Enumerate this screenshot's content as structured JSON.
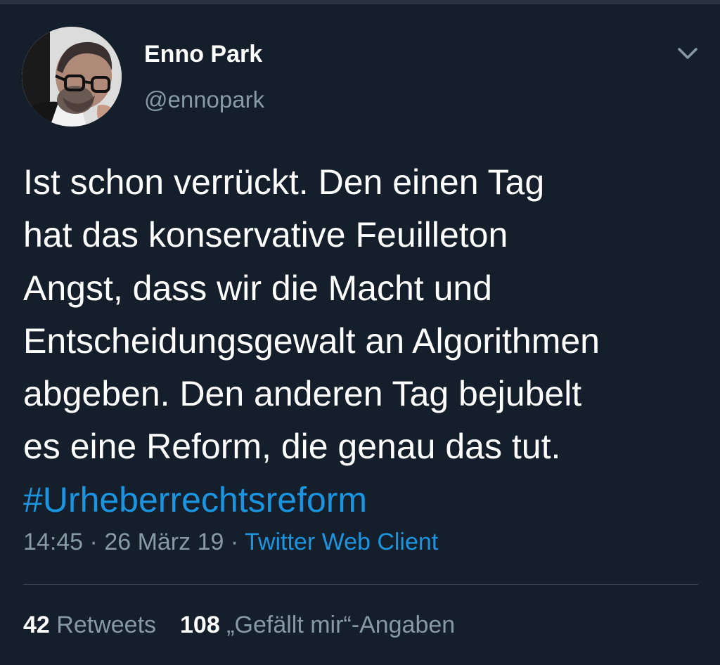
{
  "author": {
    "display_name": "Enno Park",
    "handle": "@ennopark"
  },
  "icons": {
    "menu": "chevron-down-icon",
    "avatar": "profile-photo"
  },
  "tweet": {
    "lines": [
      "Ist schon verrückt. Den einen Tag",
      "hat das konservative Feuilleton",
      "Angst, dass wir die Macht und",
      "Entscheidungsgewalt an Algorithmen",
      "abgeben. Den anderen Tag bejubelt",
      "es eine Reform, die genau das tut."
    ],
    "hashtag": "#Urheberrechtsreform"
  },
  "meta": {
    "time": "14:45",
    "separator": " · ",
    "date": "26 März 19",
    "client": "Twitter Web Client"
  },
  "stats": {
    "retweets_count": "42",
    "retweets_label": "Retweets",
    "likes_count": "108",
    "likes_label": "„Gefällt mir“-Angaben"
  },
  "colors": {
    "background": "#151f2b",
    "text": "#ffffff",
    "secondary": "#8899a6",
    "accent": "#1b95e0",
    "divider": "#38444d"
  }
}
